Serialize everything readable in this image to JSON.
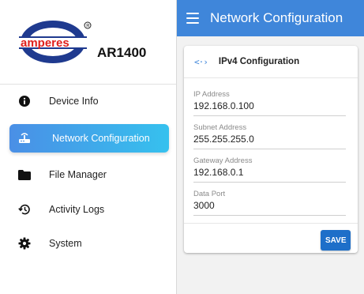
{
  "sidebar": {
    "logo_text": "amperes",
    "model": "AR1400",
    "items": [
      {
        "label": "Device Info",
        "icon": "info-icon"
      },
      {
        "label": "Network Configuration",
        "icon": "network-icon",
        "active": true
      },
      {
        "label": "File Manager",
        "icon": "folder-icon"
      },
      {
        "label": "Activity Logs",
        "icon": "history-icon"
      },
      {
        "label": "System",
        "icon": "gear-icon"
      }
    ]
  },
  "header": {
    "title": "Network Configuration"
  },
  "card": {
    "title": "IPv4 Configuration",
    "icon_glyph": "<·›",
    "fields": [
      {
        "label": "IP Address",
        "value": "192.168.0.100"
      },
      {
        "label": "Subnet Address",
        "value": "255.255.255.0"
      },
      {
        "label": "Gateway Address",
        "value": "192.168.0.1"
      },
      {
        "label": "Data Port",
        "value": "3000"
      }
    ],
    "save_label": "SAVE"
  },
  "colors": {
    "header_bg": "#3f86da",
    "active_gradient_start": "#4a8fe6",
    "active_gradient_end": "#36c1ee",
    "save_bg": "#1e6fc9",
    "logo_red": "#e0201c",
    "logo_blue": "#1f3a8f"
  }
}
